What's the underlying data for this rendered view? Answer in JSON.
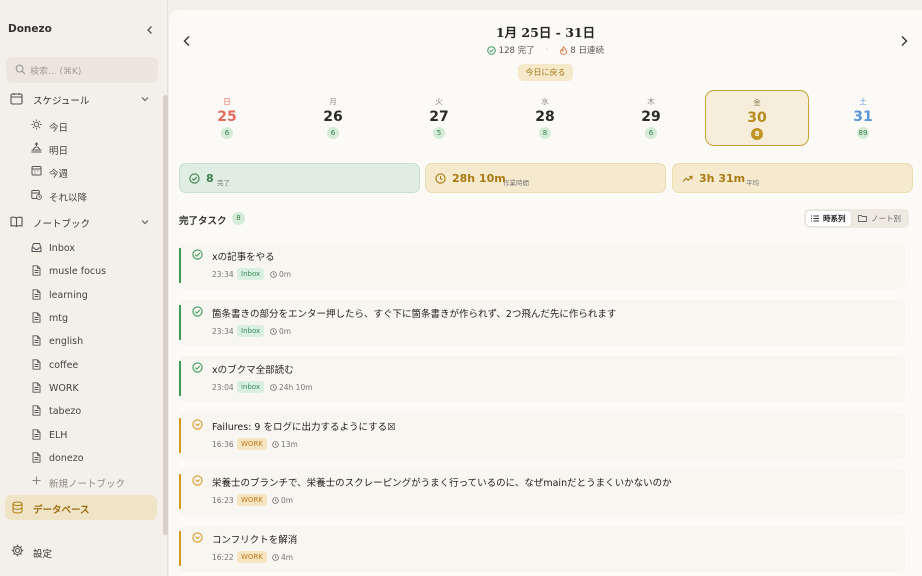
{
  "app": {
    "name": "Donezo"
  },
  "search": {
    "placeholder": "検索... (⌘K)"
  },
  "sidebar": {
    "schedule_label": "スケジュール",
    "schedule_items": [
      {
        "label": "今日",
        "icon": "sun-icon"
      },
      {
        "label": "明日",
        "icon": "sunrise-icon"
      },
      {
        "label": "今週",
        "icon": "calendar-icon"
      },
      {
        "label": "それ以降",
        "icon": "calendar-clock-icon"
      }
    ],
    "notebook_label": "ノートブック",
    "notebooks": [
      "Inbox",
      "musle focus",
      "learning",
      "mtg",
      "english",
      "coffee",
      "WORK",
      "tabezo",
      "ELH",
      "donezo"
    ],
    "new_notebook": "新規ノートブック",
    "database_label": "データベース",
    "settings_label": "設定"
  },
  "header": {
    "title": "1月 25日 - 31日",
    "completed": "128 完了",
    "streak": "8 日連続",
    "today_button": "今日に戻る"
  },
  "days": [
    {
      "weekday": "日",
      "date": "25",
      "count": "6",
      "kind": "sun"
    },
    {
      "weekday": "月",
      "date": "26",
      "count": "6",
      "kind": ""
    },
    {
      "weekday": "火",
      "date": "27",
      "count": "5",
      "kind": ""
    },
    {
      "weekday": "水",
      "date": "28",
      "count": "8",
      "kind": ""
    },
    {
      "weekday": "木",
      "date": "29",
      "count": "6",
      "kind": ""
    },
    {
      "weekday": "金",
      "date": "30",
      "count": "8",
      "kind": "sel"
    },
    {
      "weekday": "土",
      "date": "31",
      "count": "89",
      "kind": "sat"
    }
  ],
  "cards": {
    "done_value": "8",
    "done_label": "完了",
    "work_value": "28h 10m",
    "work_label": "作業時間",
    "avg_value": "3h 31m",
    "avg_label": "平均"
  },
  "tasks_section": {
    "title": "完了タスク",
    "count": "8",
    "view_timeline": "時系列",
    "view_notes": "ノート別"
  },
  "tasks": [
    {
      "title": "xの記事をやる",
      "time": "23:34",
      "tag": "Inbox",
      "duration": "0m",
      "status": "green"
    },
    {
      "title": "箇条書きの部分をエンター押したら、すぐ下に箇条書きが作られず、2つ飛んだ先に作られます",
      "time": "23:34",
      "tag": "Inbox",
      "duration": "0m",
      "status": "green"
    },
    {
      "title": "xのブクマ全部読む",
      "time": "23:04",
      "tag": "inbox",
      "duration": "24h 10m",
      "status": "green"
    },
    {
      "title": "Failures: 9 をログに出力するようにする☒",
      "time": "16:36",
      "tag": "WORK",
      "duration": "13m",
      "status": "orange"
    },
    {
      "title": "栄養士のブランチで、栄養士のスクレーピングがうまく行っているのに、なぜmainだとうまくいかないのか",
      "time": "16:23",
      "tag": "WORK",
      "duration": "0m",
      "status": "orange"
    },
    {
      "title": "コンフリクトを解消",
      "time": "16:22",
      "tag": "WORK",
      "duration": "4m",
      "status": "orange"
    }
  ],
  "colors": {
    "accent": "#c19525",
    "done_green": "#3f9a5c",
    "work_orange": "#d99a22"
  }
}
